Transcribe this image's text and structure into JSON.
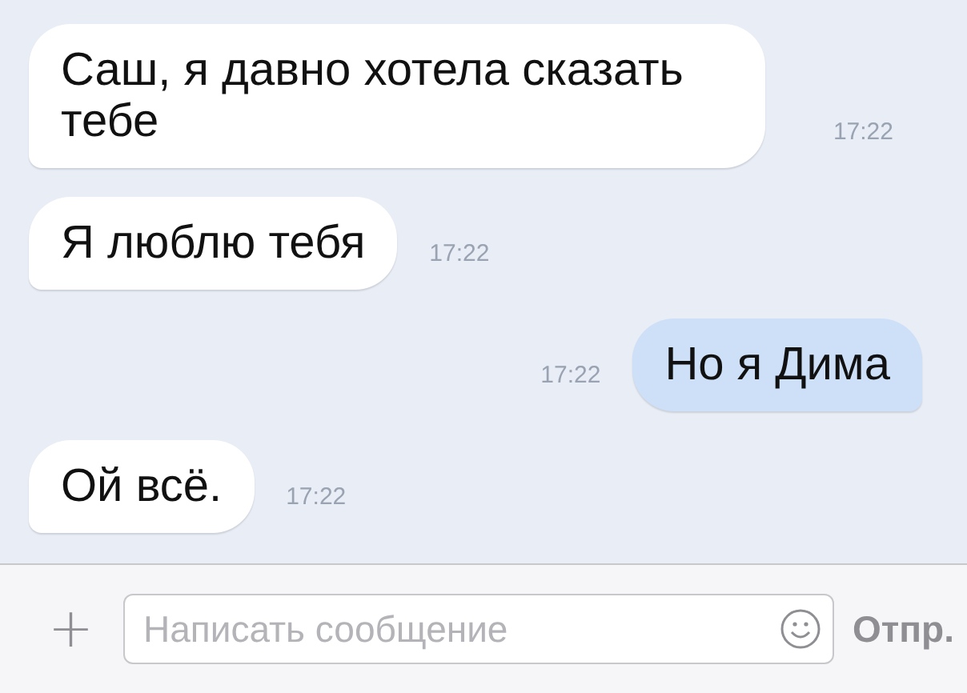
{
  "messages": [
    {
      "text": "Саш, я давно хотела сказать тебе",
      "time": "17:22",
      "outgoing": false
    },
    {
      "text": "Я люблю тебя",
      "time": "17:22",
      "outgoing": false
    },
    {
      "text": "Но я Дима",
      "time": "17:22",
      "outgoing": true
    },
    {
      "text": "Ой всё.",
      "time": "17:22",
      "outgoing": false
    }
  ],
  "composer": {
    "add_symbol": "+",
    "placeholder": "Написать сообщение",
    "send_label": "Отпр."
  }
}
